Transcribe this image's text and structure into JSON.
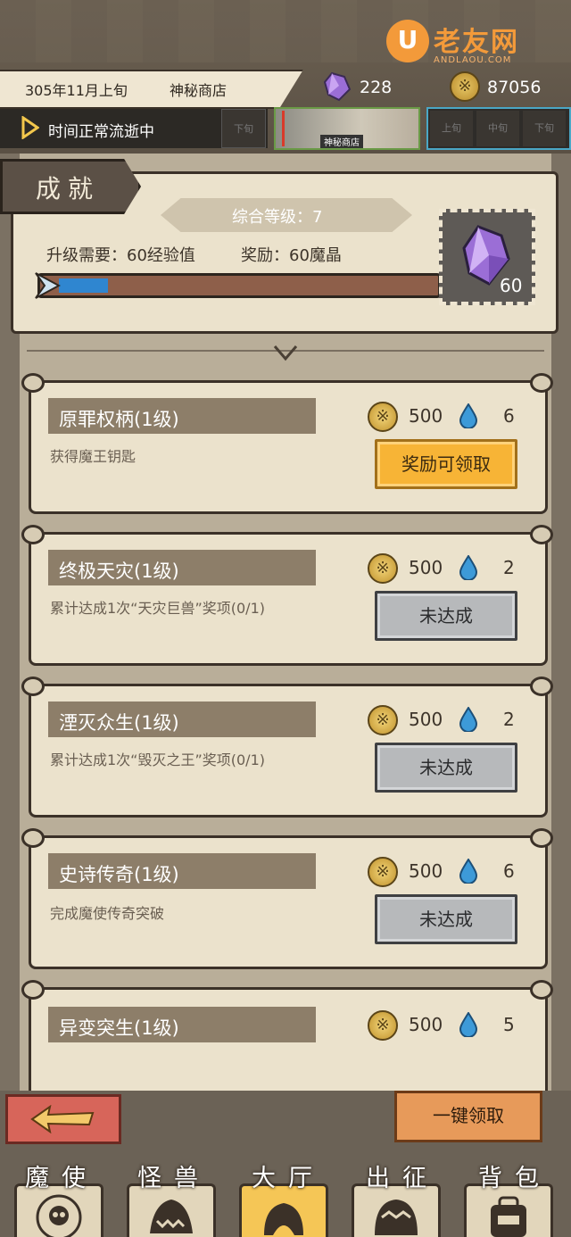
{
  "watermark": {
    "logo_glyph": "U",
    "name": "老友网",
    "domain": "ANDLAOU.COM"
  },
  "topbar": {
    "date": "305年11月上旬",
    "location": "神秘商店",
    "gems": "228",
    "coins": "87056",
    "time_status": "时间正常流逝中",
    "scene_label": "神秘商店",
    "slot_left": "下旬",
    "time_slots": [
      "上旬",
      "中旬",
      "下旬"
    ]
  },
  "header": {
    "title": "成就",
    "level": "综合等级：7",
    "requirement": "升级需要：60经验值",
    "reward": "奖励：60魔晶",
    "reward_count": "60",
    "xp_progress": 0.13
  },
  "achievements": [
    {
      "name": "原罪权柄(1级)",
      "desc": "获得魔王钥匙",
      "coins": "500",
      "drops": "6",
      "button": "奖励可领取",
      "state": "claimable"
    },
    {
      "name": "终极天灾(1级)",
      "desc": "累计达成1次“天灾巨兽”奖项(0/1)",
      "coins": "500",
      "drops": "2",
      "button": "未达成",
      "state": "locked"
    },
    {
      "name": "湮灭众生(1级)",
      "desc": "累计达成1次“毁灭之王”奖项(0/1)",
      "coins": "500",
      "drops": "2",
      "button": "未达成",
      "state": "locked"
    },
    {
      "name": "史诗传奇(1级)",
      "desc": "完成魔使传奇突破",
      "coins": "500",
      "drops": "6",
      "button": "未达成",
      "state": "locked"
    },
    {
      "name": "异变突生(1级)",
      "desc": "",
      "coins": "500",
      "drops": "5",
      "button": "",
      "state": "partial"
    }
  ],
  "footer": {
    "claim_all": "一键领取",
    "nav": [
      {
        "label": "魔使",
        "icon": "skull-emblem-icon"
      },
      {
        "label": "怪兽",
        "icon": "monster-face-icon"
      },
      {
        "label": "大厅",
        "icon": "hall-creature-icon"
      },
      {
        "label": "出征",
        "icon": "march-mask-icon"
      },
      {
        "label": "背包",
        "icon": "backpack-icon"
      }
    ],
    "active_nav": 2
  },
  "colors": {
    "claim_button": "#f7b436",
    "locked_button": "#b7b9bb",
    "xp_fill": "#2f86d0",
    "back_button": "#d7655a"
  },
  "coin_glyph": "※"
}
